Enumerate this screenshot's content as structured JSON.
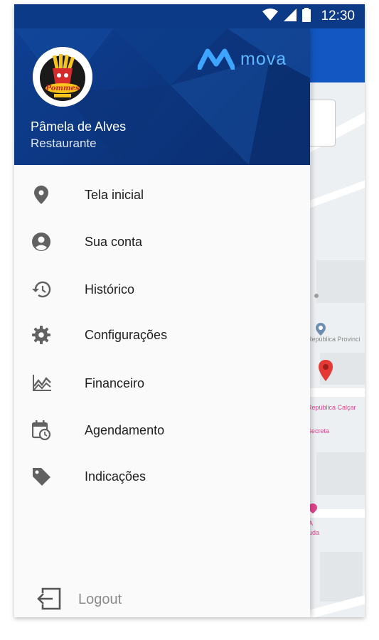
{
  "status_bar": {
    "time": "12:30",
    "icons": [
      "wifi-icon",
      "signal-icon",
      "battery-icon"
    ]
  },
  "drawer": {
    "header": {
      "avatar_logo_text": "Pommes",
      "brand": "mova",
      "user_name": "Pâmela de Alves",
      "user_role": "Restaurante"
    },
    "menu_items": [
      {
        "label": "Tela inicial",
        "icon": "location-pin-icon"
      },
      {
        "label": "Sua conta",
        "icon": "account-circle-icon"
      },
      {
        "label": "Histórico",
        "icon": "history-icon"
      },
      {
        "label": "Configurações",
        "icon": "gear-icon"
      },
      {
        "label": "Financeiro",
        "icon": "chart-icon"
      },
      {
        "label": "Agendamento",
        "icon": "calendar-clock-icon"
      },
      {
        "label": "Indicações",
        "icon": "tag-icon"
      }
    ],
    "logout": {
      "label": "Logout",
      "icon": "logout-icon"
    }
  },
  "map": {
    "labels": [
      "República Provinci",
      "República Calçar",
      "Secreta",
      "A",
      "uda"
    ]
  },
  "colors": {
    "status_bar": "#0d3a86",
    "app_bar": "#1257c2",
    "drawer_header": "#0c3680",
    "brand": "#5fb7ff",
    "map_pin": "#e53935"
  }
}
